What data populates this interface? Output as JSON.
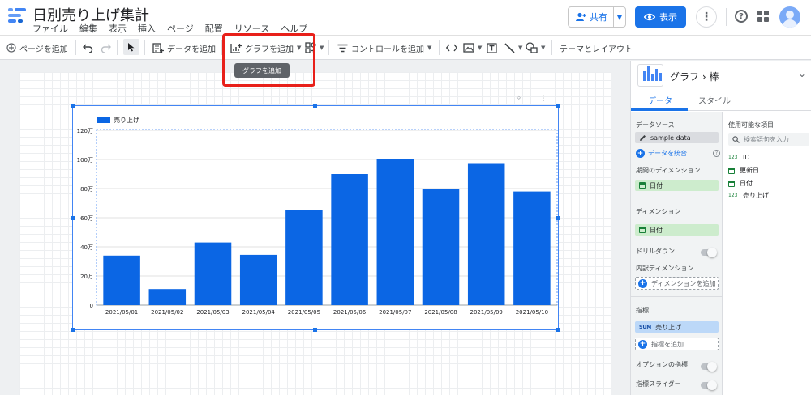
{
  "header": {
    "title": "日別売り上げ集計",
    "menu": [
      "ファイル",
      "編集",
      "表示",
      "挿入",
      "ページ",
      "配置",
      "リソース",
      "ヘルプ"
    ],
    "share_label": "共有",
    "view_label": "表示"
  },
  "toolbar": {
    "add_page": "ページを追加",
    "add_data": "データを追加",
    "add_chart": "グラフを追加",
    "add_control": "コントロールを追加",
    "theme_layout": "テーマとレイアウト",
    "tooltip": "グラフを追加"
  },
  "colors": {
    "accent": "#1a73e8",
    "bar": "#0b66e4",
    "highlight": "#e8201a"
  },
  "chart_data": {
    "type": "bar",
    "categories": [
      "2021/05/01",
      "2021/05/02",
      "2021/05/03",
      "2021/05/04",
      "2021/05/05",
      "2021/05/06",
      "2021/05/07",
      "2021/05/08",
      "2021/05/09",
      "2021/05/10"
    ],
    "series": [
      {
        "name": "売り上げ",
        "values": [
          340000,
          110000,
          430000,
          345000,
          650000,
          900000,
          1000000,
          800000,
          975000,
          780000
        ]
      }
    ],
    "ylim": [
      0,
      1200000
    ],
    "yticks": [
      0,
      200000,
      400000,
      600000,
      800000,
      1000000,
      1200000
    ],
    "ytick_labels": [
      "0",
      "20万",
      "40万",
      "60万",
      "80万",
      "100万",
      "120万"
    ],
    "grid": true,
    "legend": "top-left"
  },
  "panel": {
    "title": "グラフ",
    "subtitle": "棒",
    "tabs": [
      "データ",
      "スタイル"
    ],
    "data_source_label": "データソース",
    "data_source": "sample data",
    "blend_label": "データを統合",
    "date_dim_label": "期間のディメンション",
    "date_dim": "日付",
    "dimension_label": "ディメンション",
    "dimension": "日付",
    "drilldown_label": "ドリルダウン",
    "breakdown_label": "内訳ディメンション",
    "add_dimension": "ディメンションを追加",
    "metric_label": "指標",
    "metric_agg": "SUM",
    "metric": "売り上げ",
    "add_metric": "指標を追加",
    "optional_metric_label": "オプションの指標",
    "metric_slider_label": "指標スライダー",
    "available_label": "使用可能な項目",
    "search_placeholder": "検索語句を入力",
    "fields": [
      {
        "type": "123",
        "name": "ID"
      },
      {
        "type": "date",
        "name": "更新日"
      },
      {
        "type": "date",
        "name": "日付"
      },
      {
        "type": "123",
        "name": "売り上げ"
      }
    ]
  }
}
